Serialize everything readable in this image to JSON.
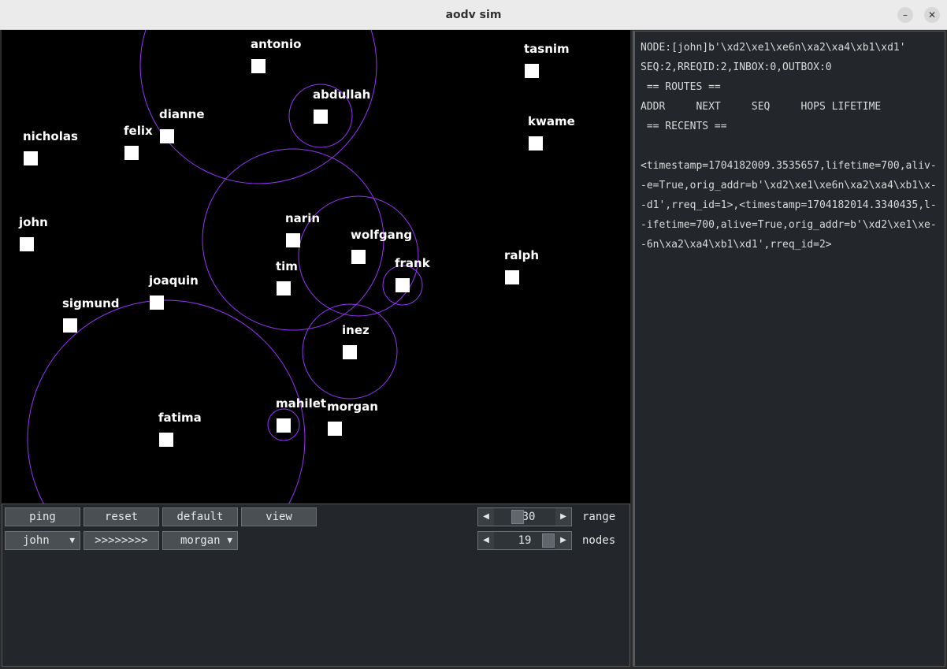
{
  "window": {
    "title": "aodv sim",
    "minimize_icon": "minimize-icon",
    "close_icon": "close-icon",
    "minimize_glyph": "–",
    "close_glyph": "✕"
  },
  "colors": {
    "canvas_bg": "#000000",
    "node": "#ffffff",
    "range_circle": "#9933ff",
    "panel_bg": "#23272b"
  },
  "nodes": [
    {
      "name": "antonio"
    },
    {
      "name": "tasnim"
    },
    {
      "name": "abdullah"
    },
    {
      "name": "dianne"
    },
    {
      "name": "felix"
    },
    {
      "name": "nicholas"
    },
    {
      "name": "kwame"
    },
    {
      "name": "john"
    },
    {
      "name": "narin"
    },
    {
      "name": "wolfgang"
    },
    {
      "name": "frank"
    },
    {
      "name": "ralph"
    },
    {
      "name": "tim"
    },
    {
      "name": "joaquin"
    },
    {
      "name": "sigmund"
    },
    {
      "name": "inez"
    },
    {
      "name": "mahilet"
    },
    {
      "name": "morgan"
    },
    {
      "name": "fatima"
    }
  ],
  "controls": {
    "ping": "ping",
    "reset": "reset",
    "default": "default",
    "view": "view",
    "source_node": "john",
    "send": ">>>>>>>>",
    "dest_node": "morgan",
    "range": {
      "label": "range",
      "value": "30"
    },
    "nodes": {
      "label": "nodes",
      "value": "19"
    },
    "arrow_left": "◀",
    "arrow_right": "▶",
    "dropdown_arrow": "▼"
  },
  "info": {
    "lines": [
      "NODE:[john]b'\\xd2\\xe1\\xe6n\\xa2\\xa4\\xb1\\xd1'",
      "SEQ:2,RREQID:2,INBOX:0,OUTBOX:0",
      " == ROUTES ==",
      "ADDR     NEXT     SEQ     HOPS LIFETIME",
      " == RECENTS ==",
      "",
      "<timestamp=1704182009.3535657,lifetime=700,aliv-",
      "-e=True,orig_addr=b'\\xd2\\xe1\\xe6n\\xa2\\xa4\\xb1\\x-",
      "-d1',rreq_id=1>,<timestamp=1704182014.3340435,l-",
      "-ifetime=700,alive=True,orig_addr=b'\\xd2\\xe1\\xe-",
      "-6n\\xa2\\xa4\\xb1\\xd1',rreq_id=2>"
    ]
  }
}
